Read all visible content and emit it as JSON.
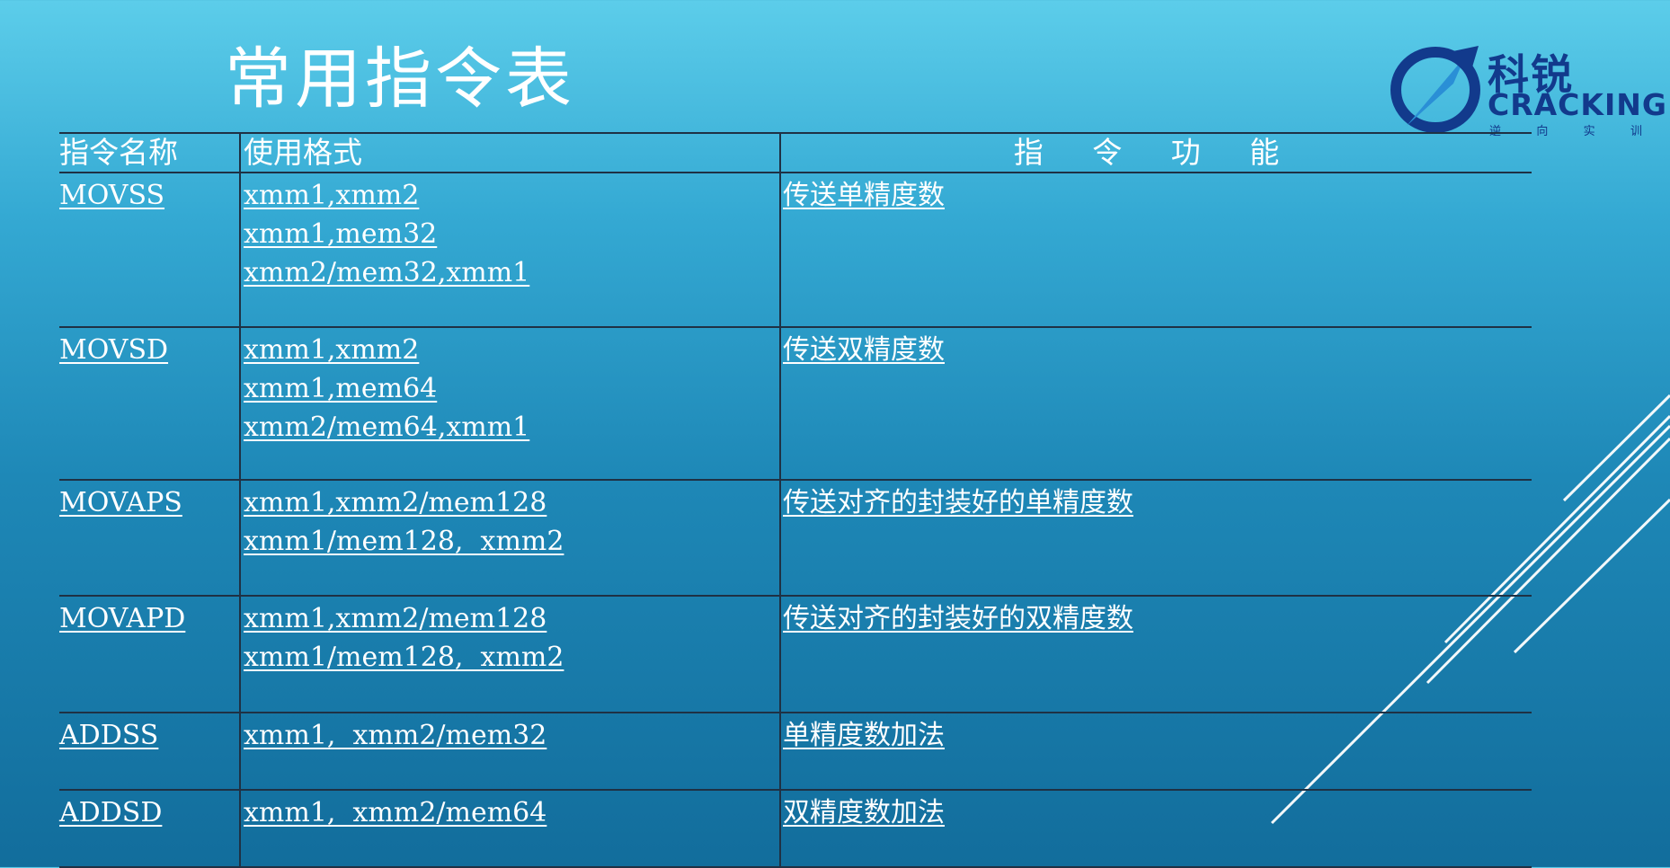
{
  "slide": {
    "title": "常用指令表"
  },
  "logo": {
    "name_cn": "科锐",
    "name_en": "CRACKING",
    "tagline_chars": [
      "逆",
      "向",
      "实",
      "训"
    ],
    "brand_color": "#123a8c"
  },
  "table": {
    "headers": [
      "指令名称",
      "使用格式",
      "指 令 功 能"
    ],
    "rows": [
      {
        "instruction": "MOVSS",
        "formats": [
          "xmm1,xmm2",
          "xmm1,mem32",
          "xmm2/mem32,xmm1"
        ],
        "function": "传送单精度数"
      },
      {
        "instruction": "MOVSD",
        "formats": [
          "xmm1,xmm2",
          "xmm1,mem64",
          "xmm2/mem64,xmm1"
        ],
        "function": "传送双精度数"
      },
      {
        "instruction": "MOVAPS",
        "formats": [
          "xmm1,xmm2/mem128",
          "xmm1/mem128,  xmm2"
        ],
        "function": "传送对齐的封装好的单精度数"
      },
      {
        "instruction": "MOVAPD",
        "formats": [
          "xmm1,xmm2/mem128",
          "xmm1/mem128,  xmm2"
        ],
        "function": "传送对齐的封装好的双精度数"
      },
      {
        "instruction": "ADDSS",
        "formats": [
          "xmm1,  xmm2/mem32"
        ],
        "function": "单精度数加法"
      },
      {
        "instruction": "ADDSD",
        "formats": [
          "xmm1,  xmm2/mem64"
        ],
        "function": "双精度数加法"
      }
    ]
  },
  "colors": {
    "background_top": "#5ccdea",
    "background_bottom": "#126d9c",
    "rule_lines": "#1f3144",
    "text": "#ffffff"
  }
}
